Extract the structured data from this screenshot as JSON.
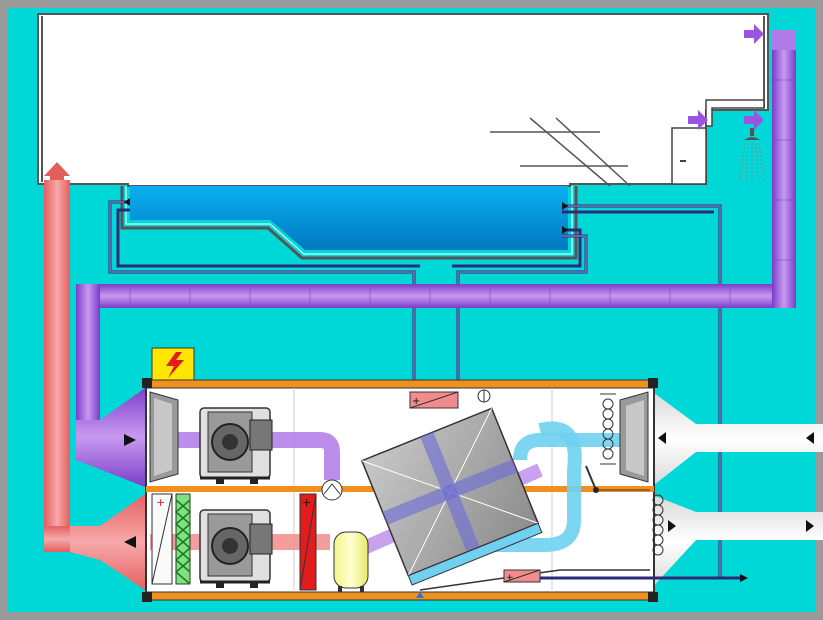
{
  "diagram": {
    "type": "HVAC schematic — indoor pool air-handling unit",
    "colors": {
      "frame": "#9a9a9a",
      "background": "#00d8d8",
      "hall": "#ffffff",
      "pool_water": "#0092d8",
      "outdoor_duct": "#f28c8c",
      "supply_duct": "#9a55e0",
      "exhaust_duct": "#ffffff",
      "unit_trim": "#f0901e",
      "recovery_flow": "#6fd1ef",
      "heater": "#e21c1c",
      "tank": "#ffffa0",
      "warning": "#ffe600"
    },
    "icons": [
      "warning-bolt-icon",
      "shower-icon",
      "supply-arrow-icon",
      "outdoor-air-arrow-icon",
      "fan-icon",
      "filter-icon",
      "heating-coil-icon",
      "heat-exchanger-icon",
      "damper-icon",
      "tank-icon",
      "electric-heater-icon",
      "exhaust-arrow-icon"
    ],
    "components": {
      "fans": 2,
      "filters": 4,
      "heaters": 3,
      "water_heater_symbols": [
        "+",
        "+",
        "+"
      ]
    }
  }
}
